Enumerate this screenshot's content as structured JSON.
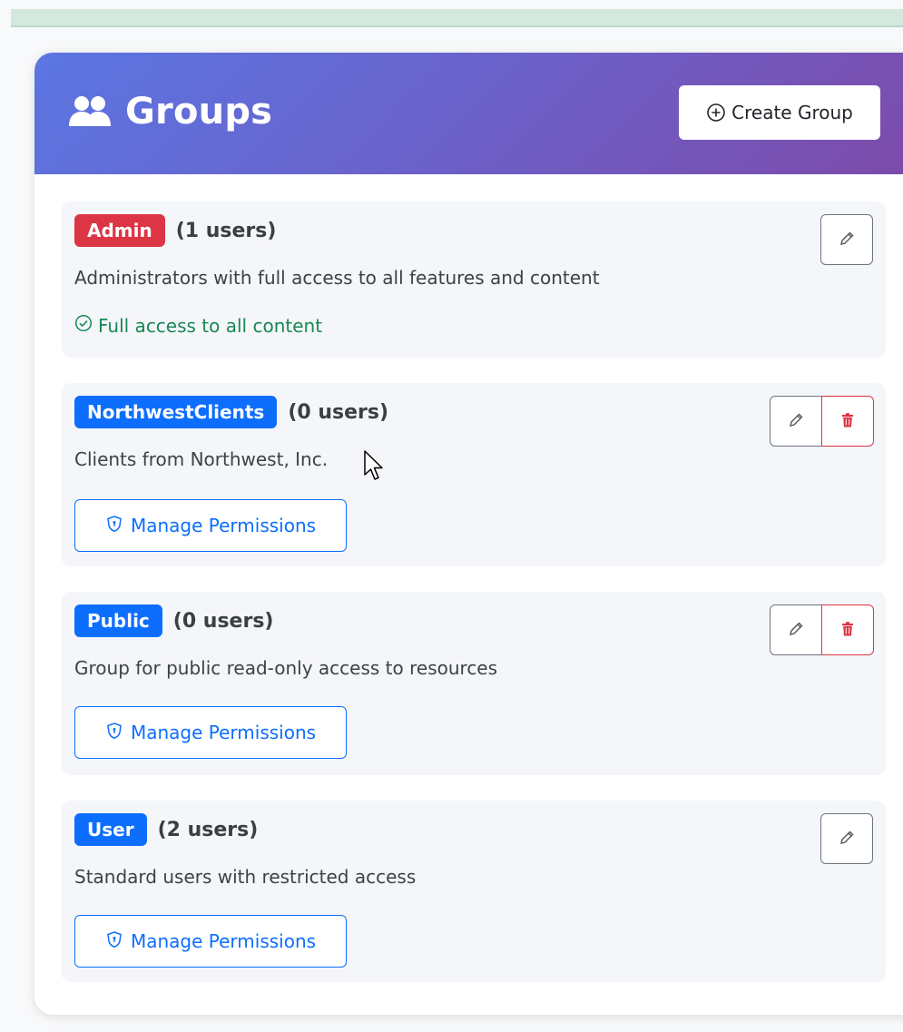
{
  "header": {
    "title": "Groups",
    "title_icon": "people-icon",
    "create_button_label": "Create Group"
  },
  "groups": [
    {
      "name": "Admin",
      "badge_color": "#dc3545",
      "users_label": "(1 users)",
      "description": "Administrators with full access to all features and content",
      "access_note": "Full access to all content",
      "deletable": false
    },
    {
      "name": "NorthwestClients",
      "badge_color": "#0d6efd",
      "users_label": "(0 users)",
      "description": "Clients from Northwest, Inc.",
      "permissions_label": "Manage Permissions",
      "deletable": true
    },
    {
      "name": "Public",
      "badge_color": "#0d6efd",
      "users_label": "(0 users)",
      "description": "Group for public read-only access to resources",
      "permissions_label": "Manage Permissions",
      "deletable": true
    },
    {
      "name": "User",
      "badge_color": "#0d6efd",
      "users_label": "(2 users)",
      "description": "Standard users with restricted access",
      "permissions_label": "Manage Permissions",
      "deletable": false
    }
  ],
  "colors": {
    "header_gradient_start": "#5b76e2",
    "header_gradient_end": "#7d4aa9",
    "primary": "#0d6efd",
    "danger": "#dc3545",
    "success": "#198754"
  }
}
